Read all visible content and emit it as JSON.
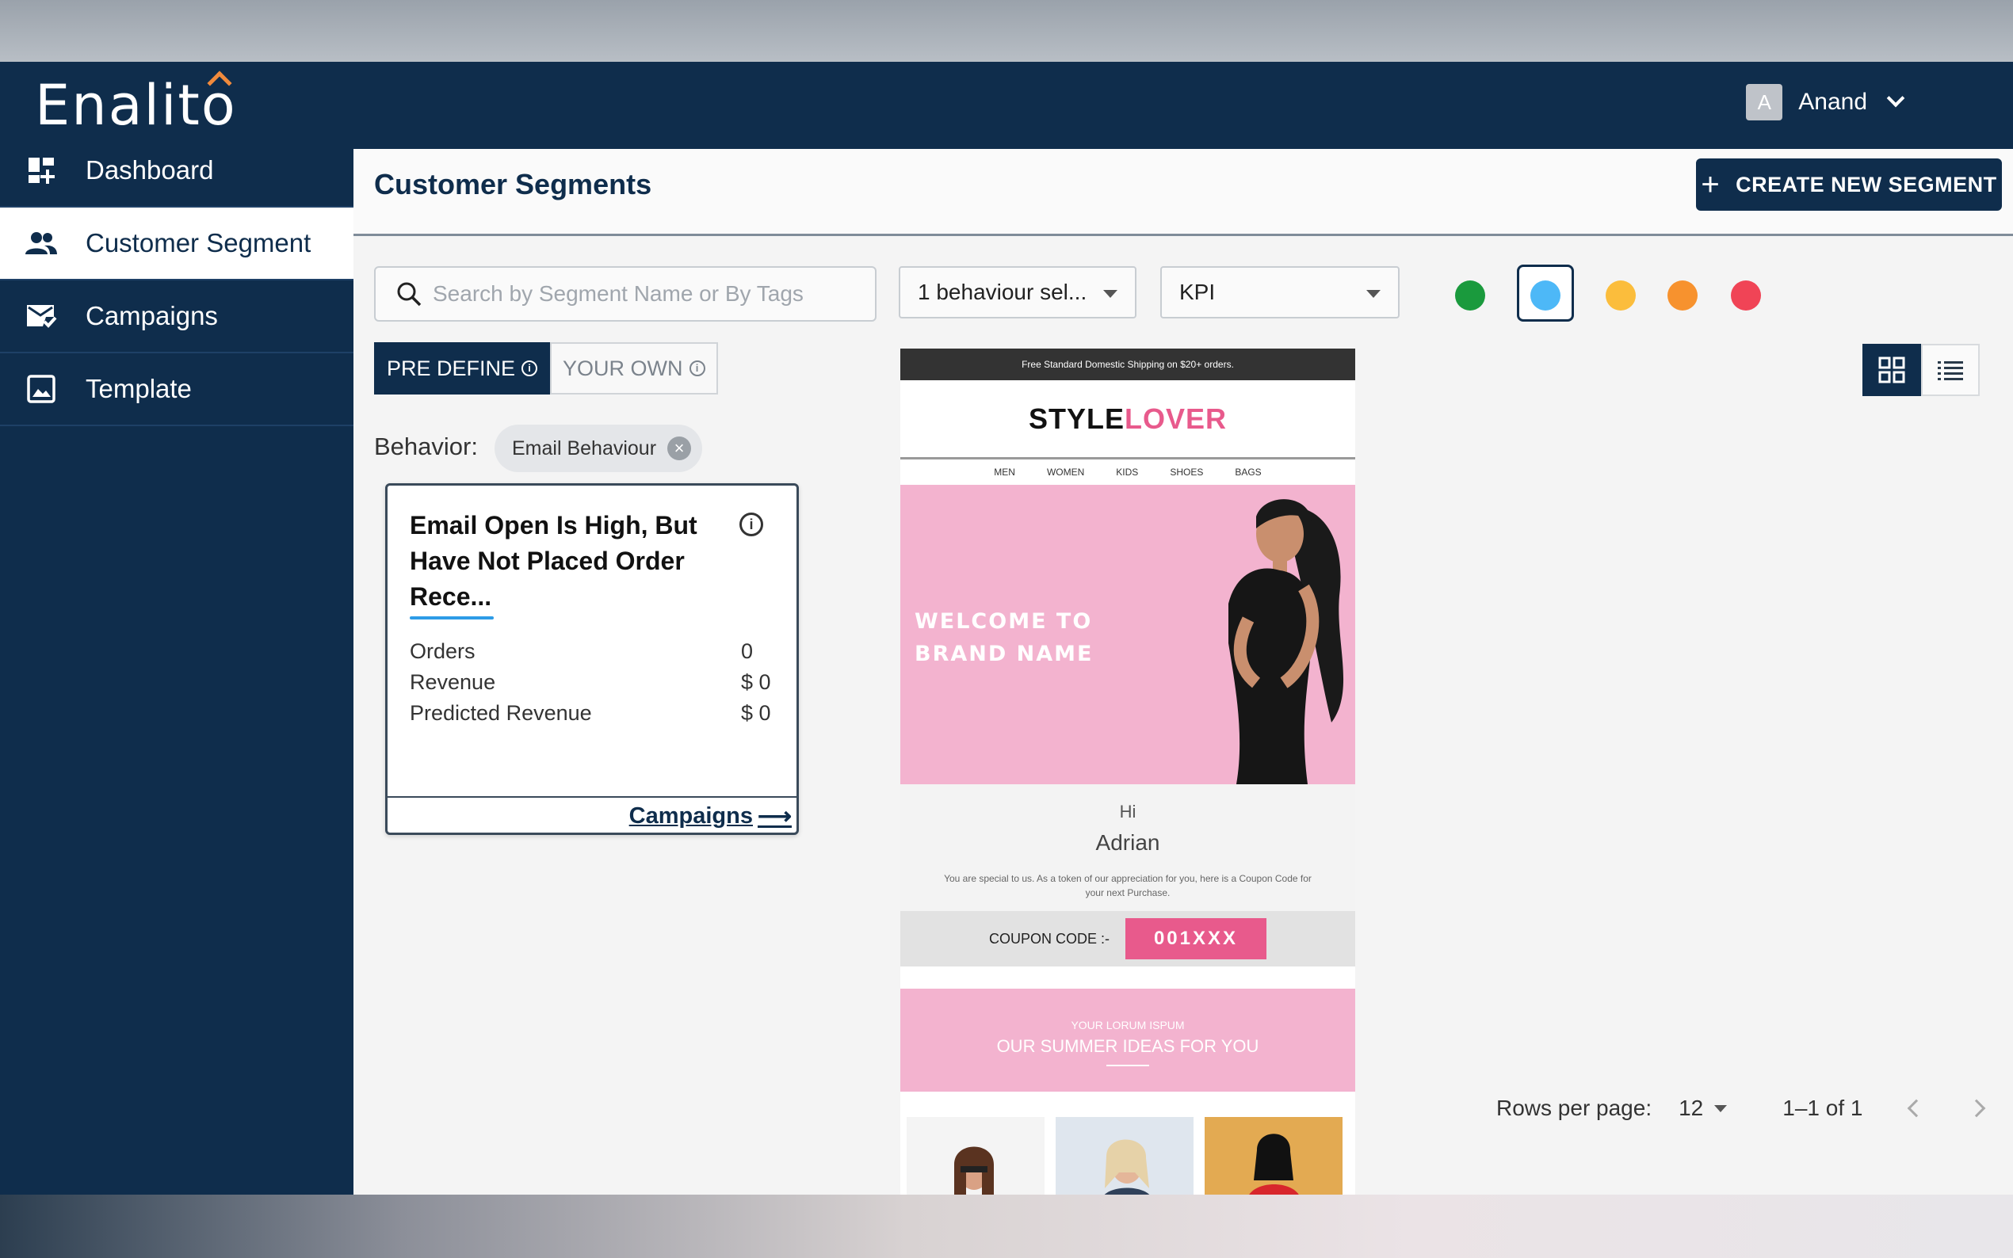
{
  "app": {
    "logo": "Enalito",
    "user_initial": "A",
    "user_name": "Anand"
  },
  "sidebar": {
    "items": [
      {
        "label": "Dashboard",
        "icon": "dashboard-icon",
        "active": false
      },
      {
        "label": "Customer Segment",
        "icon": "people-icon",
        "active": true
      },
      {
        "label": "Campaigns",
        "icon": "mail-check-icon",
        "active": false
      },
      {
        "label": "Template",
        "icon": "image-icon",
        "active": false
      }
    ]
  },
  "page": {
    "title": "Customer Segments",
    "create_button": "CREATE NEW SEGMENT"
  },
  "filters": {
    "search_placeholder": "Search by Segment Name or By Tags",
    "behaviour_select": "1 behaviour sel...",
    "kpi_select": "KPI",
    "colors": [
      "#1a9a3d",
      "#4db8f7",
      "#fbbd3c",
      "#f7922e",
      "#f04456"
    ],
    "selected_color": "#4db8f7"
  },
  "tabs": {
    "predefine": "PRE DEFINE",
    "your_own": "YOUR OWN"
  },
  "behavior": {
    "label": "Behavior:",
    "chip": "Email Behaviour"
  },
  "segment_card": {
    "title": "Email Open Is High, But Have Not Placed Order Rece...",
    "metrics": [
      {
        "label": "Orders",
        "value": "0"
      },
      {
        "label": "Revenue",
        "value": "$ 0"
      },
      {
        "label": "Predicted Revenue",
        "value": "$ 0"
      }
    ],
    "link": "Campaigns"
  },
  "email_preview": {
    "top_bar": "Free Standard Domestic Shipping on $20+ orders.",
    "brand_a": "STYLE",
    "brand_b": "LOVER",
    "menu": [
      "MEN",
      "WOMEN",
      "KIDS",
      "SHOES",
      "BAGS"
    ],
    "hero_line1": "WELCOME TO",
    "hero_line2": "BRAND NAME",
    "greeting": "Hi",
    "name": "Adrian",
    "message": "You are special to us. As a token of our appreciation for you, here is a Coupon Code for your next Purchase.",
    "coupon_label": "COUPON CODE :-",
    "coupon_code": "001XXX",
    "banner_sub": "YOUR LORUM ISPUM",
    "banner_main": "OUR SUMMER IDEAS FOR YOU"
  },
  "pagination": {
    "rows_label": "Rows per page:",
    "rows_value": "12",
    "range": "1–1 of 1"
  }
}
